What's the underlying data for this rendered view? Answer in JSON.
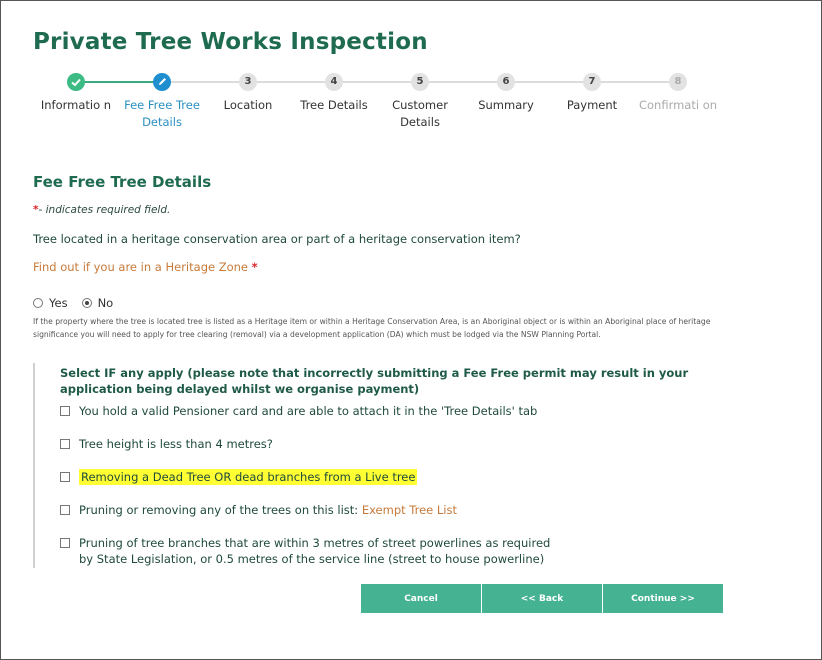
{
  "page": {
    "title": "Private Tree Works Inspection"
  },
  "stepper": {
    "steps": [
      {
        "num": "",
        "label": "Informatio n",
        "state": "done"
      },
      {
        "num": "",
        "label": "Fee Free Tree Details",
        "state": "active"
      },
      {
        "num": "3",
        "label": "Location",
        "state": "pending"
      },
      {
        "num": "4",
        "label": "Tree Details",
        "state": "pending"
      },
      {
        "num": "5",
        "label": "Customer Details",
        "state": "pending"
      },
      {
        "num": "6",
        "label": "Summary",
        "state": "pending"
      },
      {
        "num": "7",
        "label": "Payment",
        "state": "pending"
      },
      {
        "num": "8",
        "label": "Confirmati on",
        "state": "disabled"
      }
    ]
  },
  "form": {
    "section_title": "Fee Free Tree Details",
    "required_star": "*",
    "required_note": "- indicates required field.",
    "question": "Tree located in a heritage conservation area or part of a heritage conservation item?",
    "heritage_link": "Find out if you are in a Heritage Zone",
    "heritage_star": "*",
    "radio": {
      "yes": "Yes",
      "no": "No",
      "selected": "No"
    },
    "heritage_note": "If the property where the tree is located tree is listed as a Heritage item or within a Heritage Conservation Area, is an Aboriginal object or is within an Aboriginal place of heritage significance you will need to apply for tree clearing (removal) via a development application (DA) which must be lodged via the NSW Planning Portal.",
    "apply_title": "Select IF any apply (please note that incorrectly submitting a Fee Free permit may result in your application being delayed whilst we organise payment)",
    "options": {
      "pensioner": "You hold a valid Pensioner card and are able to attach it in the 'Tree Details' tab",
      "height": "Tree height is less than 4 metres?",
      "dead": "Removing a Dead Tree OR dead branches from a Live tree",
      "exempt_prefix": "Pruning or removing any of the trees on this list:",
      "exempt_link": "Exempt Tree List",
      "powerlines": "Pruning of tree branches that are within 3 metres of street powerlines as required by State Legislation, or 0.5 metres of the service line (street to house powerline)"
    }
  },
  "buttons": {
    "cancel": "Cancel",
    "back": "<< Back",
    "continue": "Continue >>"
  },
  "colors": {
    "brand_green": "#1e6b50",
    "button_green": "#45b391",
    "active_blue": "#1f8fd0",
    "highlight": "#ffff33",
    "link_orange": "#c77a3a"
  }
}
